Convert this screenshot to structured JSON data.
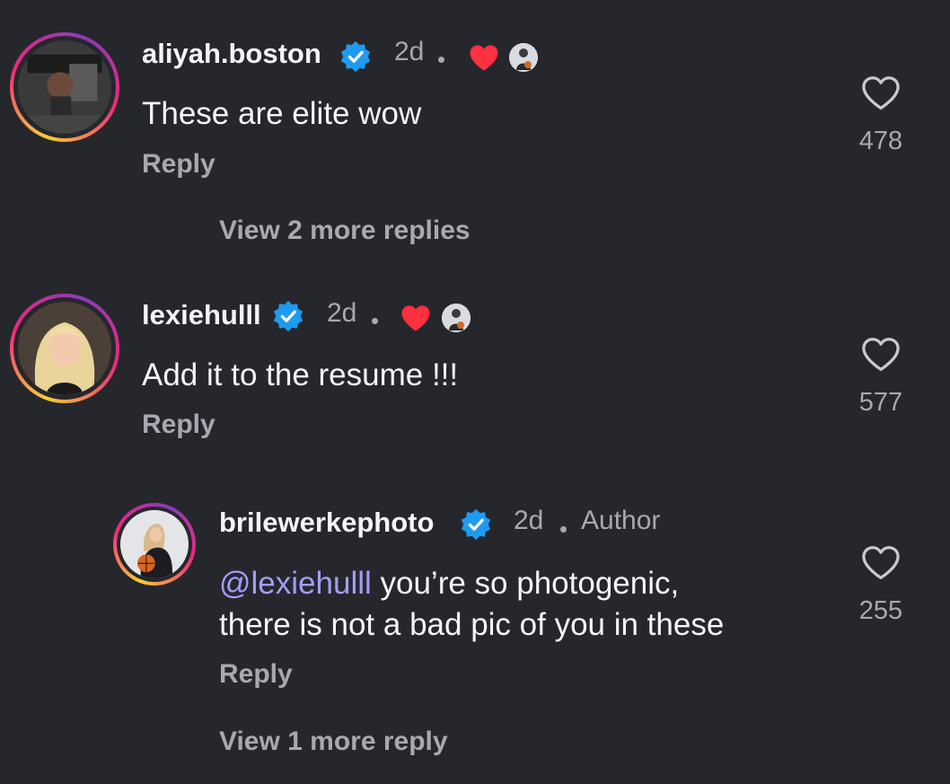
{
  "comments": [
    {
      "username": "aliyah.boston",
      "time": "2d",
      "text": "These are elite wow",
      "reply_label": "Reply",
      "likes": "478",
      "view_more": "View 2 more replies"
    },
    {
      "username": "lexiehulll",
      "time": "2d",
      "text": "Add it to the resume !!!",
      "reply_label": "Reply",
      "likes": "577"
    },
    {
      "username": "brilewerkephoto",
      "time": "2d",
      "author_label": "Author",
      "mention": "@lexiehulll",
      "text_line1": " you’re so photogenic,",
      "text_line2": "there is not a bad pic of you in these",
      "reply_label": "Reply",
      "likes": "255",
      "view_more": "View 1 more reply"
    }
  ],
  "colors": {
    "background": "#26272d",
    "verified": "#1d9bf0",
    "heart_liked": "#ff3040",
    "mention": "#a59df5",
    "muted_text": "#a8a9b0"
  },
  "icons": {
    "verified": "verified-badge-icon",
    "liked_by_author": "heart-filled-icon",
    "like": "heart-outline-icon"
  }
}
